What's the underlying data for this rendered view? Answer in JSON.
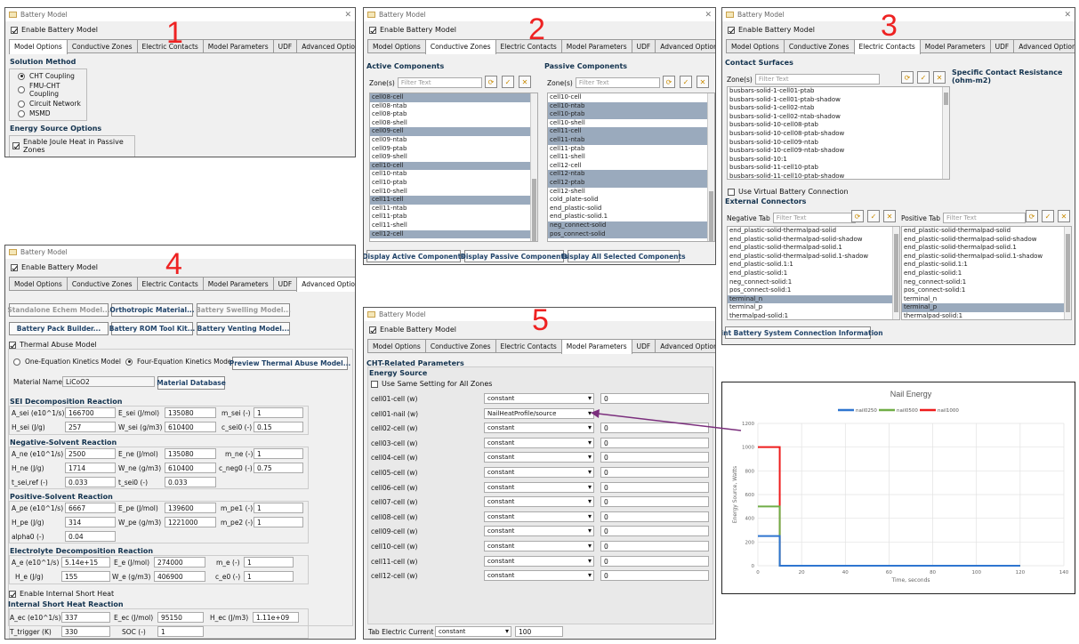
{
  "window_title": "Battery Model",
  "enable": "Enable Battery Model",
  "close": "✕",
  "tabs": {
    "t1": "Model Options",
    "t2": "Conductive Zones",
    "t3": "Electric Contacts",
    "t4": "Model Parameters",
    "t5": "UDF",
    "t6": "Advanced Options"
  },
  "p1": {
    "num": "1",
    "sol_method": "Solution Method",
    "opt1": "CHT Coupling",
    "opt2": "FMU-CHT Coupling",
    "opt3": "Circuit Network",
    "opt4": "MSMD",
    "energy_opts": "Energy Source Options",
    "joule": "Enable Joule Heat in Passive Zones"
  },
  "p2": {
    "num": "2",
    "active": "Active Components",
    "passive": "Passive Components",
    "zones": "Zone(s)",
    "filter": "Filter Text",
    "active_items": [
      "cell08-cell",
      "cell08-ntab",
      "cell08-ptab",
      "cell08-shell",
      "cell09-cell",
      "cell09-ntab",
      "cell09-ptab",
      "cell09-shell",
      "cell10-cell",
      "cell10-ntab",
      "cell10-ptab",
      "cell10-shell",
      "cell11-cell",
      "cell11-ntab",
      "cell11-ptab",
      "cell11-shell",
      "cell12-cell"
    ],
    "passive_items": [
      "cell10-cell",
      "cell10-ntab",
      "cell10-ptab",
      "cell10-shell",
      "cell11-cell",
      "cell11-ntab",
      "cell11-ptab",
      "cell11-shell",
      "cell12-cell",
      "cell12-ntab",
      "cell12-ptab",
      "cell12-shell",
      "cold_plate-solid",
      "end_plastic-solid",
      "end_plastic-solid.1",
      "neg_connect-solid",
      "pos_connect-solid"
    ],
    "b1": "Display Active Components",
    "b2": "Display Passive Components",
    "b3": "Display All Selected Components"
  },
  "p3": {
    "num": "3",
    "contact": "Contact Surfaces",
    "zones": "Zone(s)",
    "filter": "Filter Text",
    "resist": "Specific Contact Resistance (ohm-m2)",
    "items": [
      "busbars-solid-1-cell01-ptab",
      "busbars-solid-1-cell01-ptab-shadow",
      "busbars-solid-1-cell02-ntab",
      "busbars-solid-1-cell02-ntab-shadow",
      "busbars-solid-10-cell08-ptab",
      "busbars-solid-10-cell08-ptab-shadow",
      "busbars-solid-10-cell09-ntab",
      "busbars-solid-10-cell09-ntab-shadow",
      "busbars-solid-10:1",
      "busbars-solid-11-cell10-ptab",
      "busbars-solid-11-cell10-ptab-shadow"
    ],
    "virtual": "Use Virtual Battery Connection",
    "ext": "External Connectors",
    "neg": "Negative Tab",
    "pos": "Positive Tab",
    "neg_items": [
      "end_plastic-solid-thermalpad-solid",
      "end_plastic-solid-thermalpad-solid-shadow",
      "end_plastic-solid-thermalpad-solid.1",
      "end_plastic-solid-thermalpad-solid.1-shadow",
      "end_plastic-solid.1:1",
      "end_plastic-solid:1",
      "neg_connect-solid:1",
      "pos_connect-solid:1",
      "terminal_n",
      "terminal_p",
      "thermalpad-solid:1"
    ],
    "pos_items": [
      "end_plastic-solid-thermalpad-solid",
      "end_plastic-solid-thermalpad-solid-shadow",
      "end_plastic-solid-thermalpad-solid.1",
      "end_plastic-solid-thermalpad-solid.1-shadow",
      "end_plastic-solid.1:1",
      "end_plastic-solid:1",
      "neg_connect-solid:1",
      "pos_connect-solid:1",
      "terminal_n",
      "terminal_p",
      "thermalpad-solid:1"
    ],
    "print": "Print Battery System Connection Information"
  },
  "p4": {
    "num": "4",
    "b1": "Standalone Echem Model...",
    "b2": "Orthotropic Material...",
    "b3": "Battery Swelling Model...",
    "b4": "Battery Pack Builder...",
    "b5": "Battery ROM Tool Kit...",
    "b6": "Battery Venting Model...",
    "thermal": "Thermal Abuse Model",
    "one_eq": "One-Equation Kinetics Model",
    "four_eq": "Four-Equation Kinetics Model",
    "preview": "Preview Thermal Abuse Model...",
    "matname": "Material Name",
    "matval": "LiCoO2",
    "matdb": "Material Database",
    "sei": "SEI Decomposition Reaction",
    "a_sei": "A_sei (e10^1/s)",
    "a_sei_v": "166700",
    "e_sei": "E_sei (J/mol)",
    "e_sei_v": "135080",
    "m_sei": "m_sei (-)",
    "m_sei_v": "1",
    "h_sei": "H_sei (J/g)",
    "h_sei_v": "257",
    "w_sei": "W_sei (g/m3)",
    "w_sei_v": "610400",
    "c_sei": "c_sei0 (-)",
    "c_sei_v": "0.15",
    "ne": "Negative-Solvent Reaction",
    "a_ne": "A_ne (e10^1/s)",
    "a_ne_v": "2500",
    "e_ne": "E_ne (J/mol)",
    "e_ne_v": "135080",
    "m_ne": "m_ne (-)",
    "m_ne_v": "1",
    "h_ne": "H_ne (J/g)",
    "h_ne_v": "1714",
    "w_ne": "W_ne (g/m3)",
    "w_ne_v": "610400",
    "c_ne": "c_neg0 (-)",
    "c_ne_v": "0.75",
    "t_sei": "t_sei,ref (-)",
    "t_sei_v": "0.033",
    "t_sei0": "t_sei0 (-)",
    "t_sei0_v": "0.033",
    "pe": "Positive-Solvent Reaction",
    "a_pe": "A_pe (e10^1/s)",
    "a_pe_v": "6667",
    "e_pe": "E_pe (J/mol)",
    "e_pe_v": "139600",
    "m_pe1": "m_pe1 (-)",
    "m_pe1_v": "1",
    "h_pe": "H_pe (J/g)",
    "h_pe_v": "314",
    "w_pe": "W_pe (g/m3)",
    "w_pe_v": "1221000",
    "m_pe2": "m_pe2 (-)",
    "m_pe2_v": "1",
    "alpha": "alpha0 (-)",
    "alpha_v": "0.04",
    "el": "Electrolyte Decomposition Reaction",
    "a_e": "A_e (e10^1/s)",
    "a_e_v": "5.14e+15",
    "e_e": "E_e (J/mol)",
    "e_e_v": "274000",
    "m_e": "m_e (-)",
    "m_e_v": "1",
    "h_e": "H_e (J/g)",
    "h_e_v": "155",
    "w_e": "W_e (g/m3)",
    "w_e_v": "406900",
    "c_e": "c_e0 (-)",
    "c_e_v": "1",
    "short": "Enable Internal Short Heat",
    "ish": "Internal Short Heat Reaction",
    "a_ec": "A_ec (e10^1/s)",
    "a_ec_v": "337",
    "e_ec": "E_ec (J/mol)",
    "e_ec_v": "95150",
    "h_ec": "H_ec (J/m3)",
    "h_ec_v": "1.11e+09",
    "t_trig": "T_trigger (K)",
    "t_trig_v": "330",
    "soc": "SOC (-)",
    "soc_v": "1"
  },
  "p5": {
    "num": "5",
    "cht": "CHT-Related Parameters",
    "es": "Energy Source",
    "same": "Use Same Setting for All Zones",
    "rows": [
      {
        "label": "cell01-cell (w)",
        "type": "constant",
        "val": "0"
      },
      {
        "label": "cell01-nail (w)",
        "type": "NailHeatProfile/source",
        "val": ""
      },
      {
        "label": "cell02-cell (w)",
        "type": "constant",
        "val": "0"
      },
      {
        "label": "cell03-cell (w)",
        "type": "constant",
        "val": "0"
      },
      {
        "label": "cell04-cell (w)",
        "type": "constant",
        "val": "0"
      },
      {
        "label": "cell05-cell (w)",
        "type": "constant",
        "val": "0"
      },
      {
        "label": "cell06-cell (w)",
        "type": "constant",
        "val": "0"
      },
      {
        "label": "cell07-cell (w)",
        "type": "constant",
        "val": "0"
      },
      {
        "label": "cell08-cell (w)",
        "type": "constant",
        "val": "0"
      },
      {
        "label": "cell09-cell (w)",
        "type": "constant",
        "val": "0"
      },
      {
        "label": "cell10-cell (w)",
        "type": "constant",
        "val": "0"
      },
      {
        "label": "cell11-cell (w)",
        "type": "constant",
        "val": "0"
      },
      {
        "label": "cell12-cell (w)",
        "type": "constant",
        "val": "0"
      }
    ],
    "tab_current": "Tab Electric Current (A)",
    "tab_type": "constant",
    "tab_val": "100"
  },
  "chart_data": {
    "type": "line",
    "title": "Nail Energy",
    "xlabel": "Time, seconds",
    "ylabel": "Energy Source, Watts",
    "xlim": [
      0,
      140
    ],
    "ylim": [
      0,
      1200
    ],
    "xticks": [
      0,
      20,
      40,
      60,
      80,
      100,
      120,
      140
    ],
    "yticks": [
      0,
      200,
      400,
      600,
      800,
      1000,
      1200
    ],
    "legend_position": "top",
    "series": [
      {
        "name": "nail0250",
        "color": "#2e75d0",
        "points": [
          [
            0,
            250
          ],
          [
            10,
            250
          ],
          [
            10,
            0
          ],
          [
            120,
            0
          ]
        ]
      },
      {
        "name": "nail0500",
        "color": "#70ad47",
        "points": [
          [
            0,
            500
          ],
          [
            10,
            500
          ],
          [
            10,
            0
          ],
          [
            120,
            0
          ]
        ]
      },
      {
        "name": "nail1000",
        "color": "#ee1c1c",
        "points": [
          [
            0,
            1000
          ],
          [
            10,
            1000
          ],
          [
            10,
            0
          ],
          [
            120,
            0
          ]
        ]
      }
    ]
  }
}
